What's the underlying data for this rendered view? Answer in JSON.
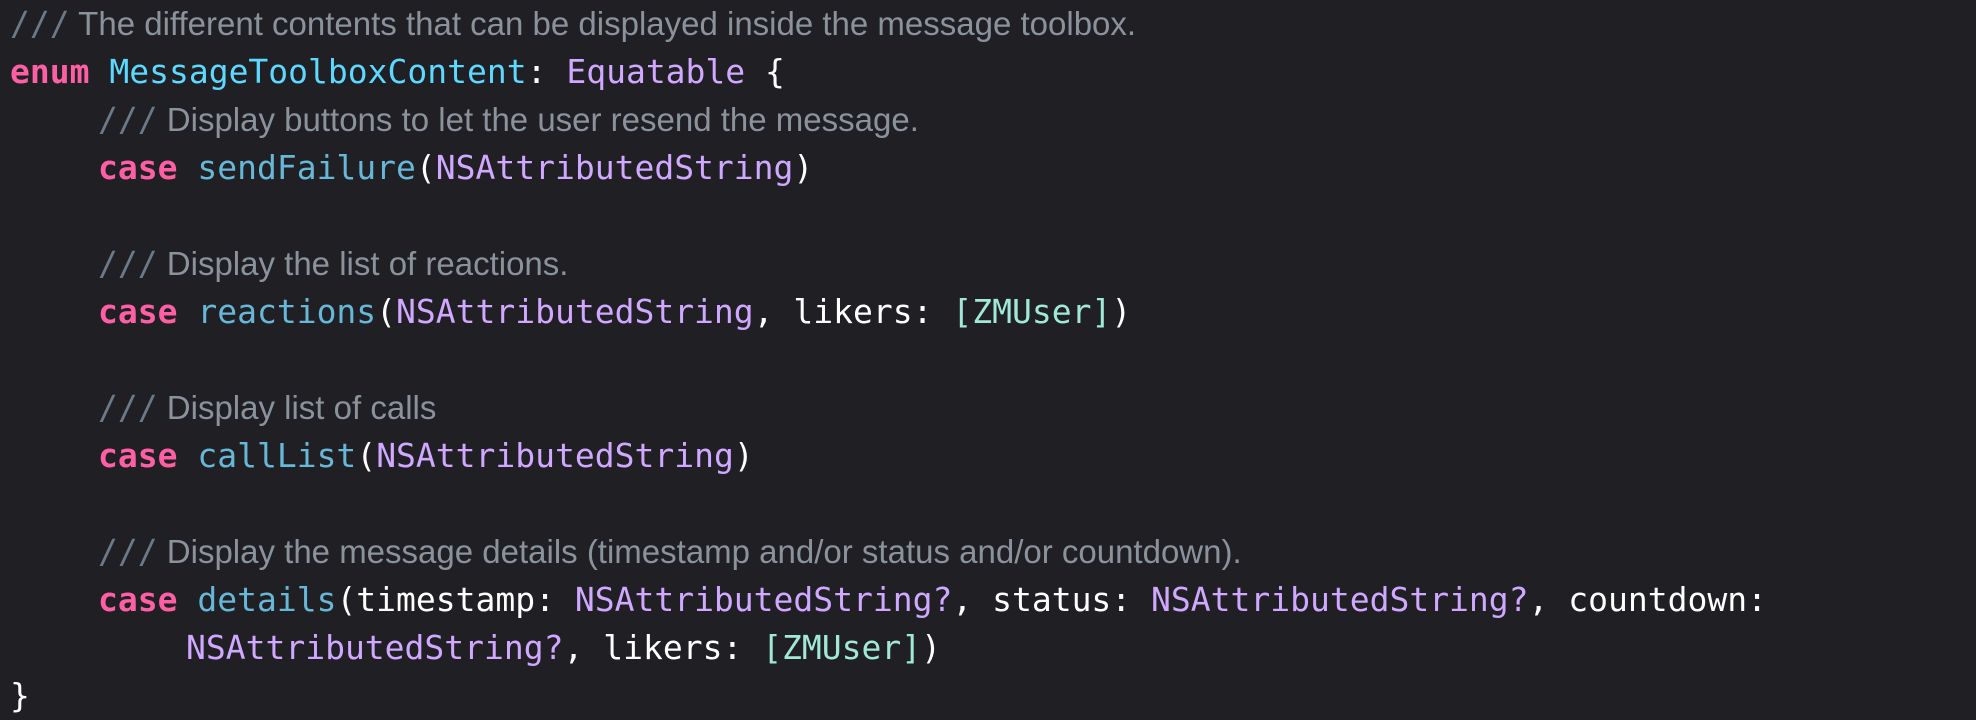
{
  "code": {
    "line1": {
      "slashes": "///",
      "comment": " The different contents that can be displayed inside the message toolbox."
    },
    "line2": {
      "kw": "enum",
      "name": "MessageToolboxContent",
      "colon": ": ",
      "proto": "Equatable",
      "brace": " {"
    },
    "line3": {
      "slashes": "///",
      "comment": " Display buttons to let the user resend the message."
    },
    "line4": {
      "kw": "case",
      "name": "sendFailure",
      "open": "(",
      "type1": "NSAttributedString",
      "close": ")"
    },
    "line6": {
      "slashes": "///",
      "comment": " Display the list of reactions."
    },
    "line7": {
      "kw": "case",
      "name": "reactions",
      "open": "(",
      "type1": "NSAttributedString",
      "sep1": ", likers: ",
      "type2": "[ZMUser]",
      "close": ")"
    },
    "line9": {
      "slashes": "///",
      "comment": " Display list of calls"
    },
    "line10": {
      "kw": "case",
      "name": "callList",
      "open": "(",
      "type1": "NSAttributedString",
      "close": ")"
    },
    "line12": {
      "slashes": "///",
      "comment": " Display the message details (timestamp and/or status and/or countdown)."
    },
    "line13": {
      "kw": "case",
      "name": "details",
      "open": "(timestamp: ",
      "type1": "NSAttributedString?",
      "sep1": ", status: ",
      "type2": "NSAttributedString?",
      "sep2": ", countdown:"
    },
    "line14": {
      "type1": "NSAttributedString?",
      "sep1": ", likers: ",
      "type2": "[ZMUser]",
      "close": ")"
    },
    "line15": {
      "brace": "}"
    }
  }
}
